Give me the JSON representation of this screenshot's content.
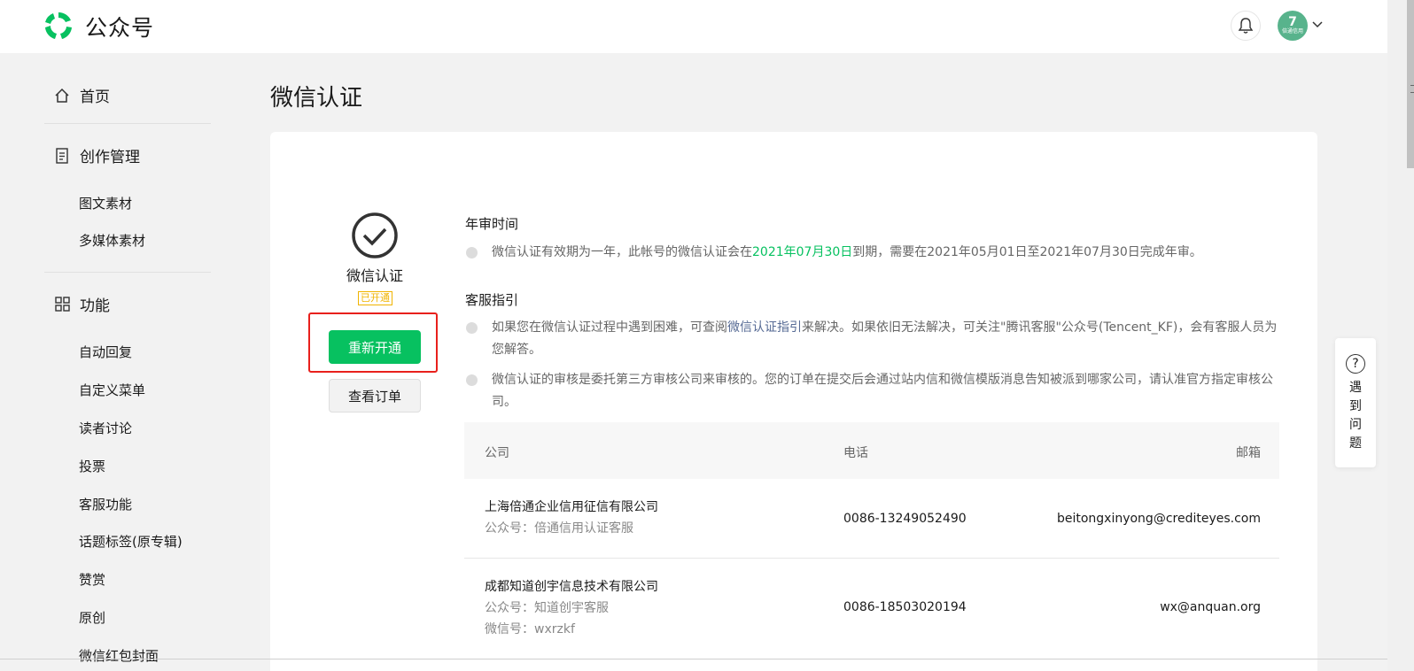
{
  "header": {
    "brand": "公众号",
    "avatar_text": "7",
    "avatar_sub": "倍通信用"
  },
  "sidebar": {
    "home": "首页",
    "creation": "创作管理",
    "creation_items": [
      "图文素材",
      "多媒体素材"
    ],
    "features": "功能",
    "feature_items": [
      "自动回复",
      "自定义菜单",
      "读者讨论",
      "投票",
      "客服功能",
      "话题标签(原专辑)",
      "赞赏",
      "原创",
      "微信红包封面"
    ]
  },
  "main": {
    "title": "微信认证",
    "status": {
      "name": "微信认证",
      "badge": "已开通",
      "renew_button": "重新开通",
      "orders_button": "查看订单"
    },
    "annual": {
      "title": "年审时间",
      "text_before": "微信认证有效期为一年，此帐号的微信认证会在",
      "date": "2021年07月30日",
      "text_after": "到期，需要在2021年05月01日至2021年07月30日完成年审。"
    },
    "service": {
      "title": "客服指引",
      "p1_before": "如果您在微信认证过程中遇到困难，可查阅",
      "p1_link": "微信认证指引",
      "p1_after": "来解决。如果依旧无法解决，可关注\"腾讯客服\"公众号(Tencent_KF)，会有客服人员为您解答。",
      "p2": "微信认证的审核是委托第三方审核公司来审核的。您的订单在提交后会通过站内信和微信模版消息告知被派到哪家公司，请认准官方指定审核公司。"
    },
    "table": {
      "headers": {
        "company": "公司",
        "phone": "电话",
        "email": "邮箱"
      },
      "rows": [
        {
          "company": "上海倍通企业信用征信有限公司",
          "sub1": "公众号：倍通信用认证客服",
          "sub2": "",
          "phone": "0086-13249052490",
          "email": "beitongxinyong@crediteyes.com"
        },
        {
          "company": "成都知道创宇信息技术有限公司",
          "sub1": "公众号：知道创宇客服",
          "sub2": "微信号：wxrzkf",
          "phone": "0086-18503020194",
          "email": "wx@anquan.org"
        }
      ]
    }
  },
  "help": {
    "icon": "?",
    "label": [
      "遇",
      "到",
      "问",
      "题"
    ]
  },
  "colors": {
    "brand_green": "#07c160",
    "highlight_red": "#e8201c",
    "badge_yellow": "#f0b400",
    "link_blue": "#576b95"
  }
}
